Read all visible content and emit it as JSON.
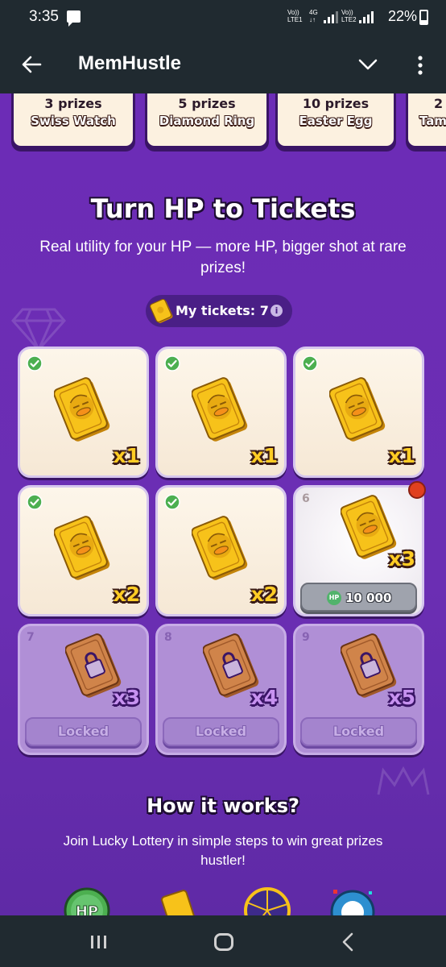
{
  "status_bar": {
    "time": "3:35",
    "sim1": {
      "top": "Vo))",
      "bottom": "LTE1"
    },
    "network": {
      "top": "4G",
      "bottom": "↓↑"
    },
    "sim2": {
      "top": "Vo))",
      "bottom": "LTE2"
    },
    "battery": "22%"
  },
  "app_bar": {
    "title": "MemHustle",
    "icons": [
      "back-arrow-icon",
      "chevron-down-icon",
      "more-vertical-icon"
    ]
  },
  "prizes": [
    {
      "count": "3 prizes",
      "name": "Swiss Watch"
    },
    {
      "count": "5 prizes",
      "name": "Diamond Ring"
    },
    {
      "count": "10 prizes",
      "name": "Easter Egg"
    },
    {
      "count": "2",
      "name": "Tam"
    }
  ],
  "hero": {
    "title": "Turn HP to Tickets",
    "subtitle": "Real utility for your HP — more HP, bigger shot at rare prizes!"
  },
  "tickets_pill": {
    "label": "My tickets: 7",
    "info": "i"
  },
  "cards": [
    {
      "state": "claimed",
      "multiplier": "x1"
    },
    {
      "state": "claimed",
      "multiplier": "x1"
    },
    {
      "state": "claimed",
      "multiplier": "x1"
    },
    {
      "state": "claimed",
      "multiplier": "x2"
    },
    {
      "state": "claimed",
      "multiplier": "x2"
    },
    {
      "state": "active",
      "number": "6",
      "multiplier": "x3",
      "coin": "HP",
      "price": "10 000"
    },
    {
      "state": "locked",
      "number": "7",
      "multiplier": "x3",
      "button": "Locked"
    },
    {
      "state": "locked",
      "number": "8",
      "multiplier": "x4",
      "button": "Locked"
    },
    {
      "state": "locked",
      "number": "9",
      "multiplier": "x5",
      "button": "Locked"
    }
  ],
  "how_it_works": {
    "title": "How it works?",
    "subtitle": "Join Lucky Lottery in simple steps to win great prizes hustler!",
    "icons": [
      "hp-coin-icon",
      "ticket-icon",
      "wheel-icon",
      "lottery-ball-icon"
    ],
    "hp_badge": "HP"
  },
  "colors": {
    "background": "#6a2fb0",
    "system_bar": "#202a30",
    "ticket_gold": "#f7c21a",
    "check_green": "#4caf50",
    "notification_red": "#e0401f"
  }
}
